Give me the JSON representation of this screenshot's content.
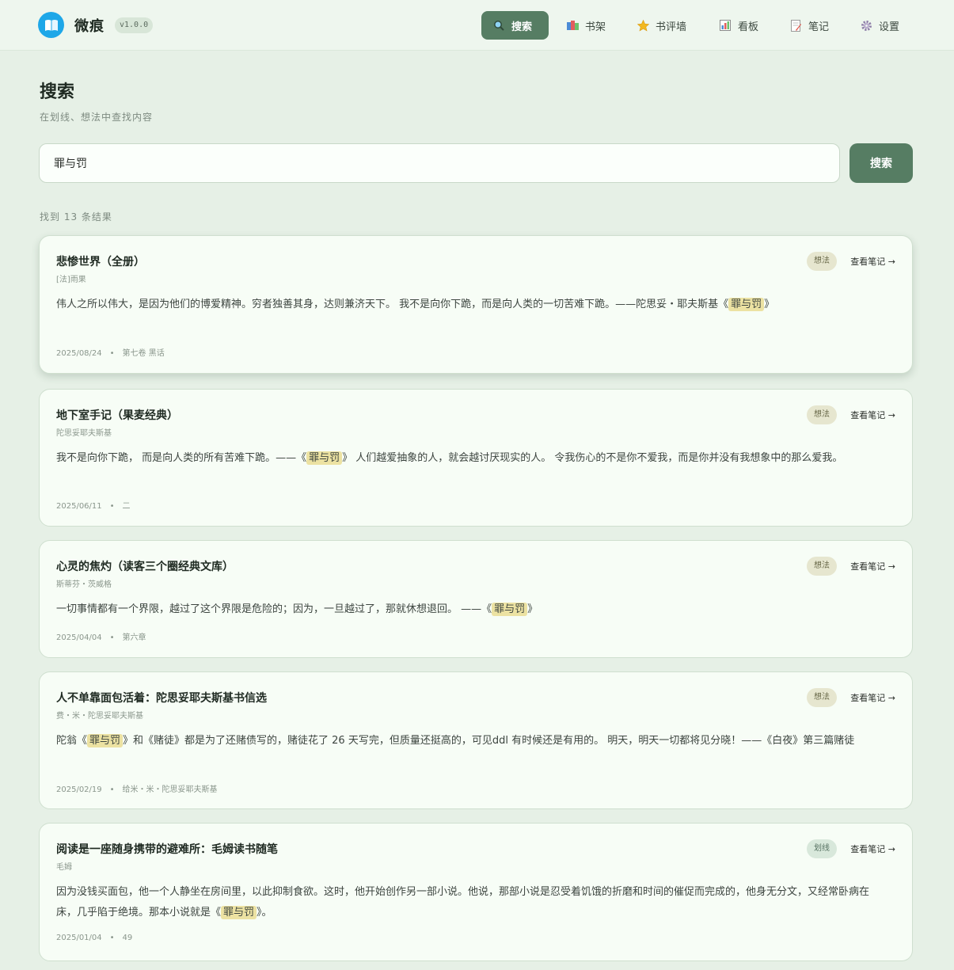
{
  "app": {
    "name": "微痕",
    "version": "v1.0.0"
  },
  "nav": [
    {
      "label": "搜索",
      "icon": "magnifier-icon",
      "active": true
    },
    {
      "label": "书架",
      "icon": "books-icon",
      "active": false
    },
    {
      "label": "书评墙",
      "icon": "star-icon",
      "active": false
    },
    {
      "label": "看板",
      "icon": "chart-icon",
      "active": false
    },
    {
      "label": "笔记",
      "icon": "memo-icon",
      "active": false
    },
    {
      "label": "设置",
      "icon": "gear-icon",
      "active": false
    }
  ],
  "page": {
    "title": "搜索",
    "subtitle": "在划线、想法中查找内容"
  },
  "search": {
    "value": "罪与罚",
    "button": "搜索"
  },
  "results_count": "找到 13 条结果",
  "colors": {
    "accent": "#567d63",
    "highlight": "#ece2a2",
    "background": "#e6f0e6"
  },
  "results": [
    {
      "title": "悲惨世界（全册）",
      "author": "[法]雨果",
      "tag": "想法",
      "link": "查看笔记 →",
      "text_before": "伟人之所以伟大，是因为他们的博爱精神。穷者独善其身，达则兼济天下。 我不是向你下跪，而是向人类的一切苦难下跪。——陀思妥・耶夫斯基《",
      "highlight": "罪与罚",
      "text_after": "》",
      "date": "2025/08/24",
      "chapter": "第七卷 黑话"
    },
    {
      "title": "地下室手记（果麦经典）",
      "author": "陀思妥耶夫斯基",
      "tag": "想法",
      "link": "查看笔记 →",
      "text_before": "我不是向你下跪， 而是向人类的所有苦难下跪。——《",
      "highlight": "罪与罚",
      "text_after": "》 人们越爱抽象的人，就会越讨厌现实的人。 令我伤心的不是你不爱我，而是你并没有我想象中的那么爱我。",
      "date": "2025/06/11",
      "chapter": "二"
    },
    {
      "title": "心灵的焦灼（读客三个圈经典文库）",
      "author": "斯蒂芬・茨威格",
      "tag": "想法",
      "link": "查看笔记 →",
      "text_before": "一切事情都有一个界限，越过了这个界限是危险的；因为，一旦越过了，那就休想退回。 ——《",
      "highlight": "罪与罚",
      "text_after": "》",
      "date": "2025/04/04",
      "chapter": "第六章"
    },
    {
      "title": "人不单靠面包活着：陀思妥耶夫斯基书信选",
      "author": "费・米・陀思妥耶夫斯基",
      "tag": "想法",
      "link": "查看笔记 →",
      "text_before": "陀翁《",
      "highlight": "罪与罚",
      "text_after": "》和《赌徒》都是为了还赌债写的，赌徒花了 26 天写完，但质量还挺高的，可见ddl 有时候还是有用的。 明天，明天一切都将见分晓！——《白夜》第三篇赌徒",
      "date": "2025/02/19",
      "chapter": "给米・米・陀思妥耶夫斯基"
    },
    {
      "title": "阅读是一座随身携带的避难所：毛姆读书随笔",
      "author": "毛姆",
      "tag": "划线",
      "link": "查看笔记 →",
      "text_before": "因为没钱买面包，他一个人静坐在房间里，以此抑制食欲。这时，他开始创作另一部小说。他说，那部小说是忍受着饥饿的折磨和时间的催促而完成的，他身无分文，又经常卧病在床，几乎陷于绝境。那本小说就是《",
      "highlight": "罪与罚",
      "text_after": "》。",
      "date": "2025/01/04",
      "chapter": "49"
    }
  ]
}
